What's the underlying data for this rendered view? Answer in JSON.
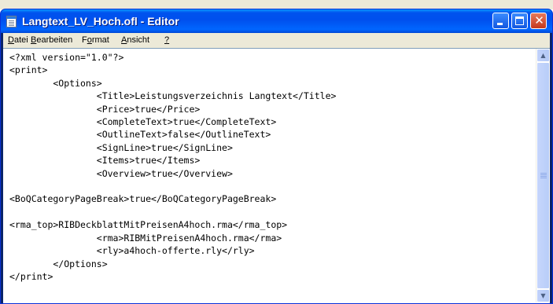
{
  "window": {
    "title": "Langtext_LV_Hoch.ofl - Editor",
    "icon": "notepad-icon",
    "controls": {
      "minimize": "minimize-icon",
      "maximize": "maximize-icon",
      "close": "close-icon"
    }
  },
  "menu": {
    "items": [
      {
        "accel": "D",
        "rest": "atei"
      },
      {
        "accel": "B",
        "rest": "earbeiten"
      },
      {
        "accel": "o",
        "pre": "F",
        "rest": "rmat"
      },
      {
        "accel": "A",
        "rest": "nsicht"
      },
      {
        "accel": "?",
        "rest": ""
      }
    ]
  },
  "editor": {
    "lines": [
      "<?xml version=\"1.0\"?>",
      "<print>",
      "\t<Options>",
      "\t\t<Title>Leistungsverzeichnis Langtext</Title>",
      "\t\t<Price>true</Price>",
      "\t\t<CompleteText>true</CompleteText>",
      "\t\t<OutlineText>false</OutlineText>",
      "\t\t<SignLine>true</SignLine>",
      "\t\t<Items>true</Items>",
      "\t\t<Overview>true</Overview>",
      "",
      "<BoQCategoryPageBreak>true</BoQCategoryPageBreak>",
      "",
      "<rma_top>RIBDeckblattMitPreisenA4hoch.rma</rma_top>",
      "\t\t<rma>RIBMitPreisenA4hoch.rma</rma>",
      "\t\t<rly>a4hoch-offerte.rly</rly>",
      "\t</Options>",
      "</print>"
    ]
  },
  "scrollbar": {
    "up": "scroll-up-arrow-icon",
    "down": "scroll-down-arrow-icon"
  }
}
